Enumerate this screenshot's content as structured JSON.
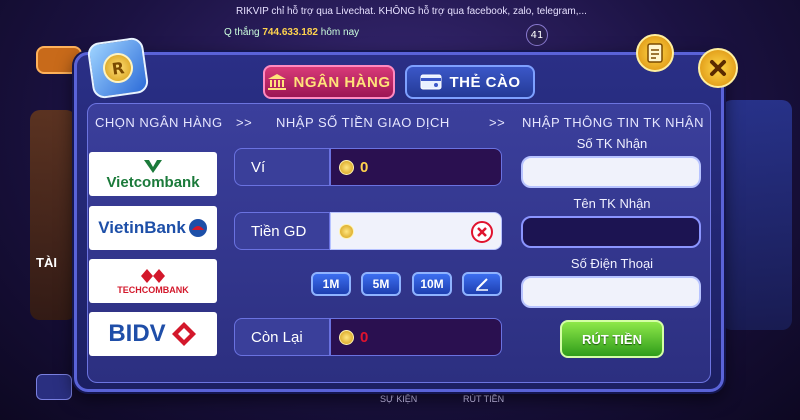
{
  "background": {
    "ticker": "RIKVIP chỉ hỗ trợ qua Livechat. KHÔNG hỗ trợ qua facebook, zalo, telegram,...",
    "winner_prefix": "Q thắng",
    "winner_amount": "744.633.182",
    "winner_suffix": "hôm nay",
    "side_label": "TÀI",
    "nav_events": "SỰ KIỆN",
    "nav_withdraw": "RÚT TIỀN",
    "room_count": "41"
  },
  "tabs": [
    {
      "label": "NGÂN HÀNG",
      "icon": "bank-icon",
      "active": true
    },
    {
      "label": "THẺ CÀO",
      "icon": "card-icon",
      "active": false
    }
  ],
  "columns": {
    "choose_bank": "CHỌN NGÂN HÀNG",
    "arrow": ">>",
    "enter_amount": "NHẬP SỐ TIỀN GIAO DỊCH",
    "receiver_info": "NHẬP THÔNG TIN TK NHẬN"
  },
  "banks": [
    {
      "name": "Vietcombank",
      "color": "#1b7a3a"
    },
    {
      "name": "VietinBank",
      "color": "#1d4fa8"
    },
    {
      "name": "TECHCOMBANK",
      "color": "#d3182b"
    },
    {
      "name": "BIDV",
      "color": "#1f4ea8"
    }
  ],
  "wallet": {
    "label": "Ví",
    "value": "0"
  },
  "transaction": {
    "label": "Tiền GD",
    "value": ""
  },
  "remaining": {
    "label": "Còn Lại",
    "value": "0"
  },
  "quick_amounts": [
    "1M",
    "5M",
    "10M"
  ],
  "receiver": {
    "account_no_label": "Số TK Nhận",
    "account_no_value": "",
    "account_name_label": "Tên TK Nhận",
    "account_name_value": "",
    "phone_label": "Số Điện Thoại",
    "phone_value": ""
  },
  "withdraw_button": "RÚT TIỀN",
  "colors": {
    "accent_pink": "#c8246a",
    "gold": "#ffd34d",
    "green": "#3fb020",
    "red": "#e0132e"
  }
}
